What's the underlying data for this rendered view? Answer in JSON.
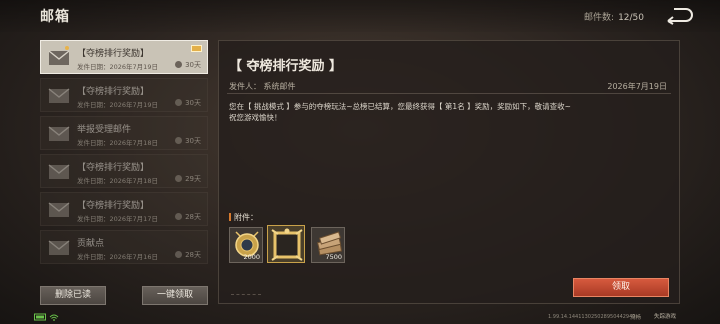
{
  "header": {
    "title": "邮箱",
    "mail_count_label": "邮件数:",
    "mail_count_value": "12/50"
  },
  "mail_list": [
    {
      "title": "【夺榜排行奖励】",
      "date": "发件日期：2026年7月19日",
      "days": "30天",
      "selected": true,
      "unread": true,
      "has_attachment": true
    },
    {
      "title": "【夺榜排行奖励】",
      "date": "发件日期：2026年7月19日",
      "days": "30天",
      "selected": false,
      "unread": false,
      "has_attachment": false
    },
    {
      "title": "举报受理邮件",
      "date": "发件日期：2026年7月18日",
      "days": "30天",
      "selected": false,
      "unread": false,
      "has_attachment": false
    },
    {
      "title": "【夺榜排行奖励】",
      "date": "发件日期：2026年7月18日",
      "days": "29天",
      "selected": false,
      "unread": false,
      "has_attachment": false
    },
    {
      "title": "【夺榜排行奖励】",
      "date": "发件日期：2026年7月17日",
      "days": "28天",
      "selected": false,
      "unread": false,
      "has_attachment": false
    },
    {
      "title": "贡献点",
      "date": "发件日期：2026年7月16日",
      "days": "28天",
      "selected": false,
      "unread": false,
      "has_attachment": false
    }
  ],
  "buttons": {
    "delete_read": "删除已读",
    "claim_all": "一键领取",
    "claim": "领取"
  },
  "detail": {
    "title": "【 夺榜排行奖励 】",
    "sender": "发件人：  系统邮件",
    "date": "2026年7月19日",
    "body_line1": "您在【 挑战模式 】参与的夺榜玩法~总榜已结算，您最终获得【 第1名 】奖励，奖励如下，敬请查收~",
    "body_line2": "祝您游戏愉快！",
    "attachments_label": "附件：",
    "attachments": [
      {
        "icon": "medal-icon",
        "qty": "2000"
      },
      {
        "icon": "golden-frame-icon",
        "qty": ""
      },
      {
        "icon": "book-stack-icon",
        "qty": "7500"
      }
    ]
  },
  "statusbar": {
    "version": "1.99.14.144113025028950442949",
    "right_text1": "流畅",
    "right_text2": "失踪游戏"
  },
  "colors": {
    "accent_claim": "#c84a31",
    "selected_item": "#c9c3b6",
    "attachment_label_bar": "#d67a2e"
  }
}
